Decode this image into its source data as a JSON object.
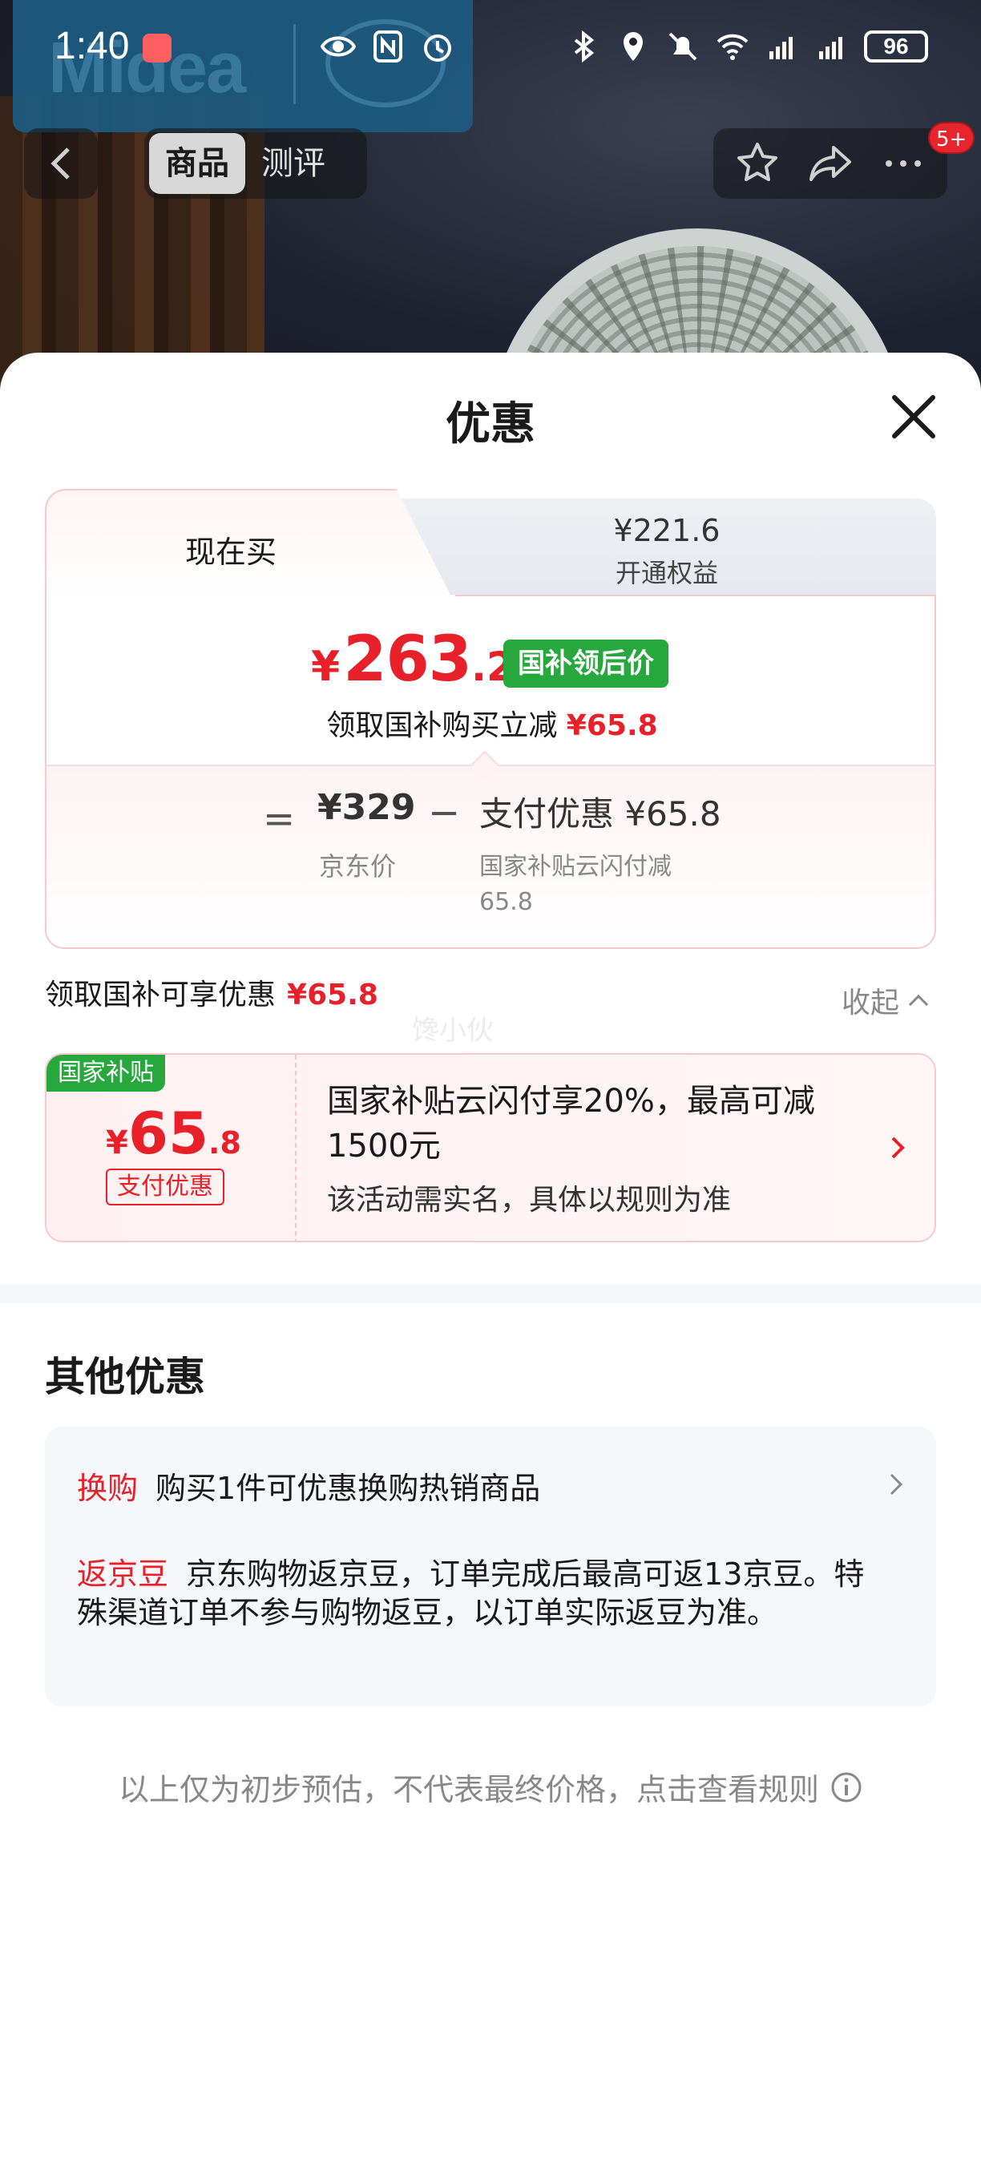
{
  "status_bar": {
    "time": "1:40",
    "battery": "96"
  },
  "nav": {
    "tabs": [
      {
        "label": "商品",
        "active": true
      },
      {
        "label": "测评",
        "active": false
      }
    ],
    "badge": "5+"
  },
  "sheet": {
    "title": "优惠",
    "price_tabs": {
      "current": "现在买",
      "member_price": "¥221.6",
      "member_label": "开通权益"
    },
    "final_price": {
      "yen": "¥",
      "integer": "263",
      "decimal": ".2",
      "tag": "国补领后价"
    },
    "instant_discount": {
      "text": "领取国补购买立减",
      "amount": "¥65.8"
    },
    "calculation": {
      "equals": "=",
      "list_price": "¥329",
      "list_price_label": "京东价",
      "minus": "−",
      "pay_discount": "支付优惠 ¥65.8",
      "pay_discount_label": "国家补贴云闪付减65.8"
    },
    "subsidy_summary": {
      "text": "领取国补可享优惠",
      "amount": "¥65.8",
      "collapse": "收起"
    },
    "watermark": "馋小伙",
    "coupon": {
      "tag": "国家补贴",
      "yen": "¥",
      "integer": "65",
      "decimal": ".8",
      "type": "支付优惠",
      "description": "国家补贴云闪付享20%，最高可减1500元",
      "note": "该活动需实名，具体以规则为准"
    },
    "other": {
      "title": "其他优惠",
      "items": [
        {
          "kind": "换购",
          "text": "购买1件可优惠换购热销商品"
        },
        {
          "kind": "返京豆",
          "text": "京东购物返京豆，订单完成后最高可返13京豆。特殊渠道订单不参与购物返豆，以订单实际返豆为准。"
        }
      ]
    },
    "footer": "以上仅为初步预估，不代表最终价格，点击查看规则"
  },
  "colors": {
    "accent_red": "#e8202a",
    "subsidy_green": "#27a83c"
  }
}
